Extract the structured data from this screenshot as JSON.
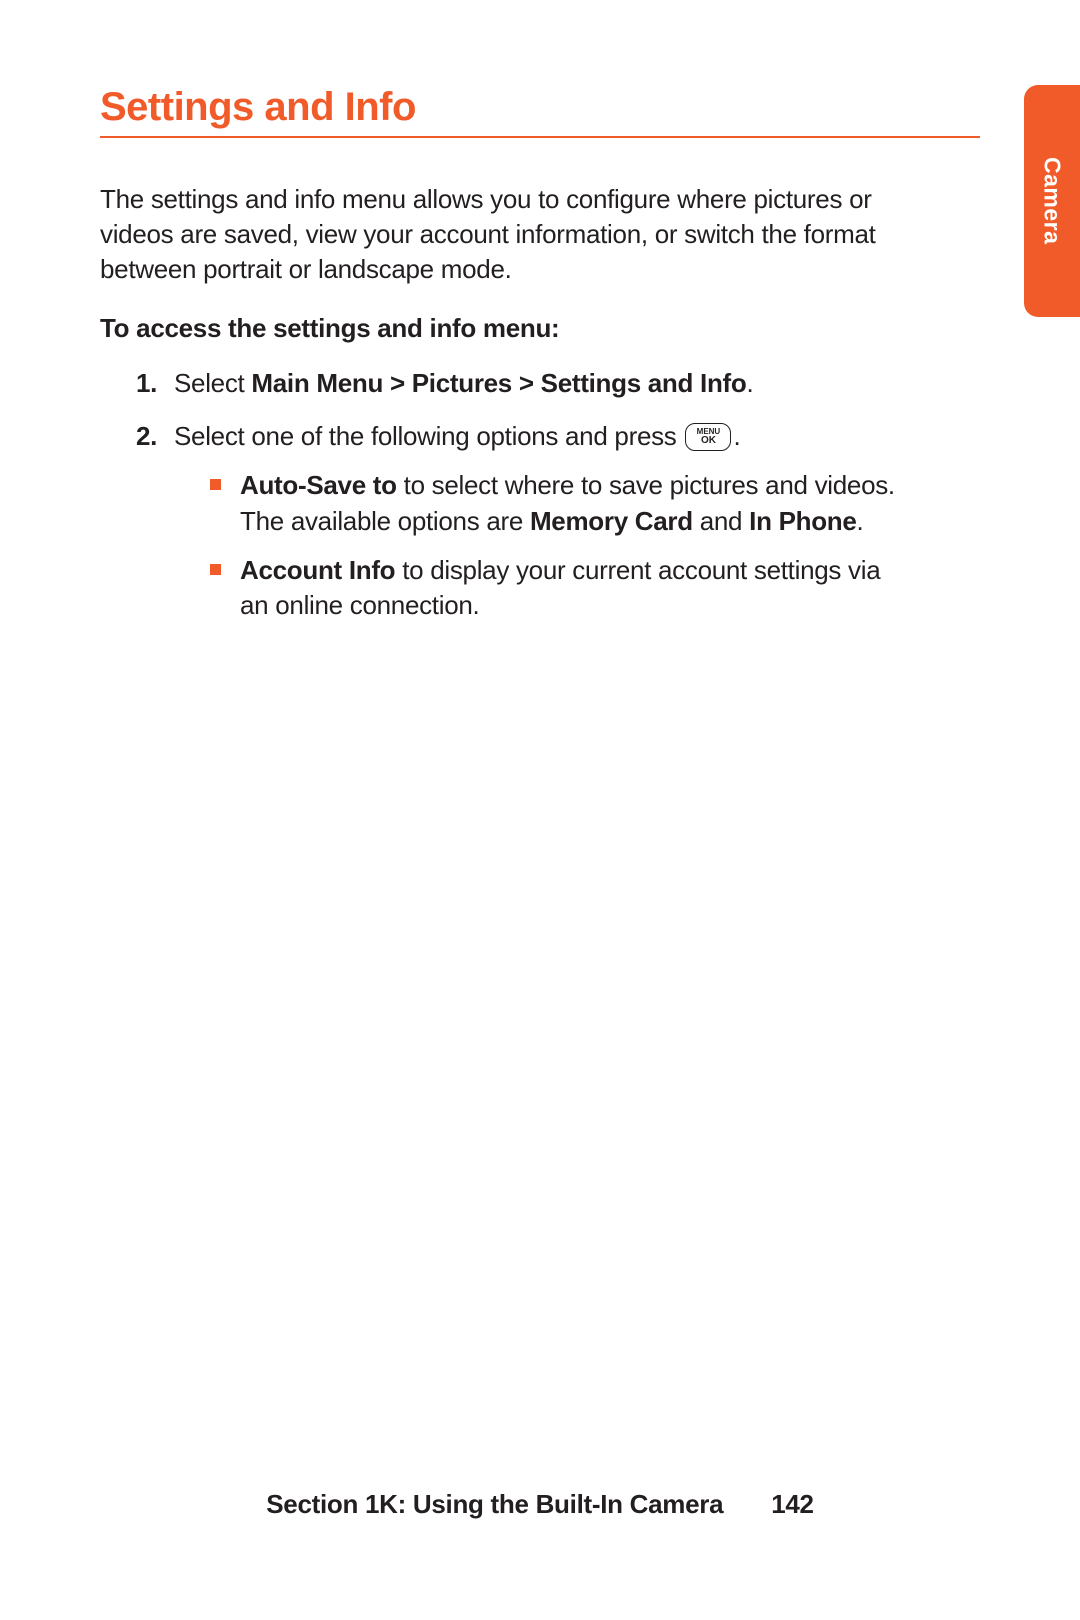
{
  "heading": "Settings and Info",
  "sideTab": "Camera",
  "intro": "The settings and info menu allows you to configure where pictures or videos are saved, view your account information, or switch the format between portrait or landscape mode.",
  "subheading": "To access the settings and info menu:",
  "steps": {
    "one": {
      "num": "1.",
      "prefix": "Select ",
      "bold": "Main Menu > Pictures > Settings and Info",
      "suffix": "."
    },
    "two": {
      "num": "2.",
      "prefix": "Select one of the following options and press ",
      "iconTop": "MENU",
      "iconBottom": "OK",
      "suffix": "."
    }
  },
  "bullets": {
    "a": {
      "b1": "Auto-Save to",
      "t1": " to select where to save pictures and videos. The available options are ",
      "b2": "Memory Card",
      "t2": " and ",
      "b3": "In Phone",
      "t3": "."
    },
    "b": {
      "b1": "Account Info",
      "t1": " to display your current account settings via an online connection."
    }
  },
  "footer": {
    "section": "Section 1K: Using the Built-In Camera",
    "page": "142"
  }
}
